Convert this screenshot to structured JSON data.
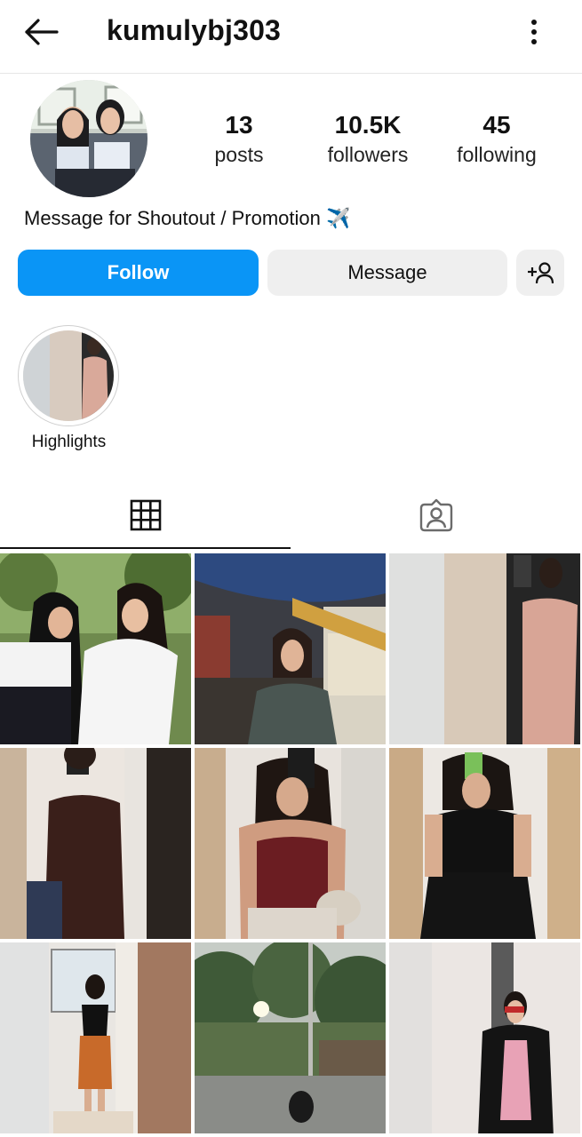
{
  "header": {
    "username": "kumulybj303",
    "back_icon": "arrow-left-icon",
    "menu_icon": "more-vertical-icon"
  },
  "profile": {
    "stats": [
      {
        "value": "13",
        "label": "posts"
      },
      {
        "value": "10.5K",
        "label": "followers"
      },
      {
        "value": "45",
        "label": "following"
      }
    ],
    "bio": "Message for Shoutout / Promotion ✈️"
  },
  "actions": {
    "follow_label": "Follow",
    "message_label": "Message",
    "add_user_icon": "add-person-icon"
  },
  "highlights": [
    {
      "label": "Highlights"
    }
  ],
  "tabs": [
    {
      "icon": "grid-icon",
      "active": true
    },
    {
      "icon": "tagged-person-icon",
      "active": false
    }
  ],
  "colors": {
    "primary": "#0a95f6",
    "secondary_button": "#efefef",
    "text": "#111111"
  }
}
